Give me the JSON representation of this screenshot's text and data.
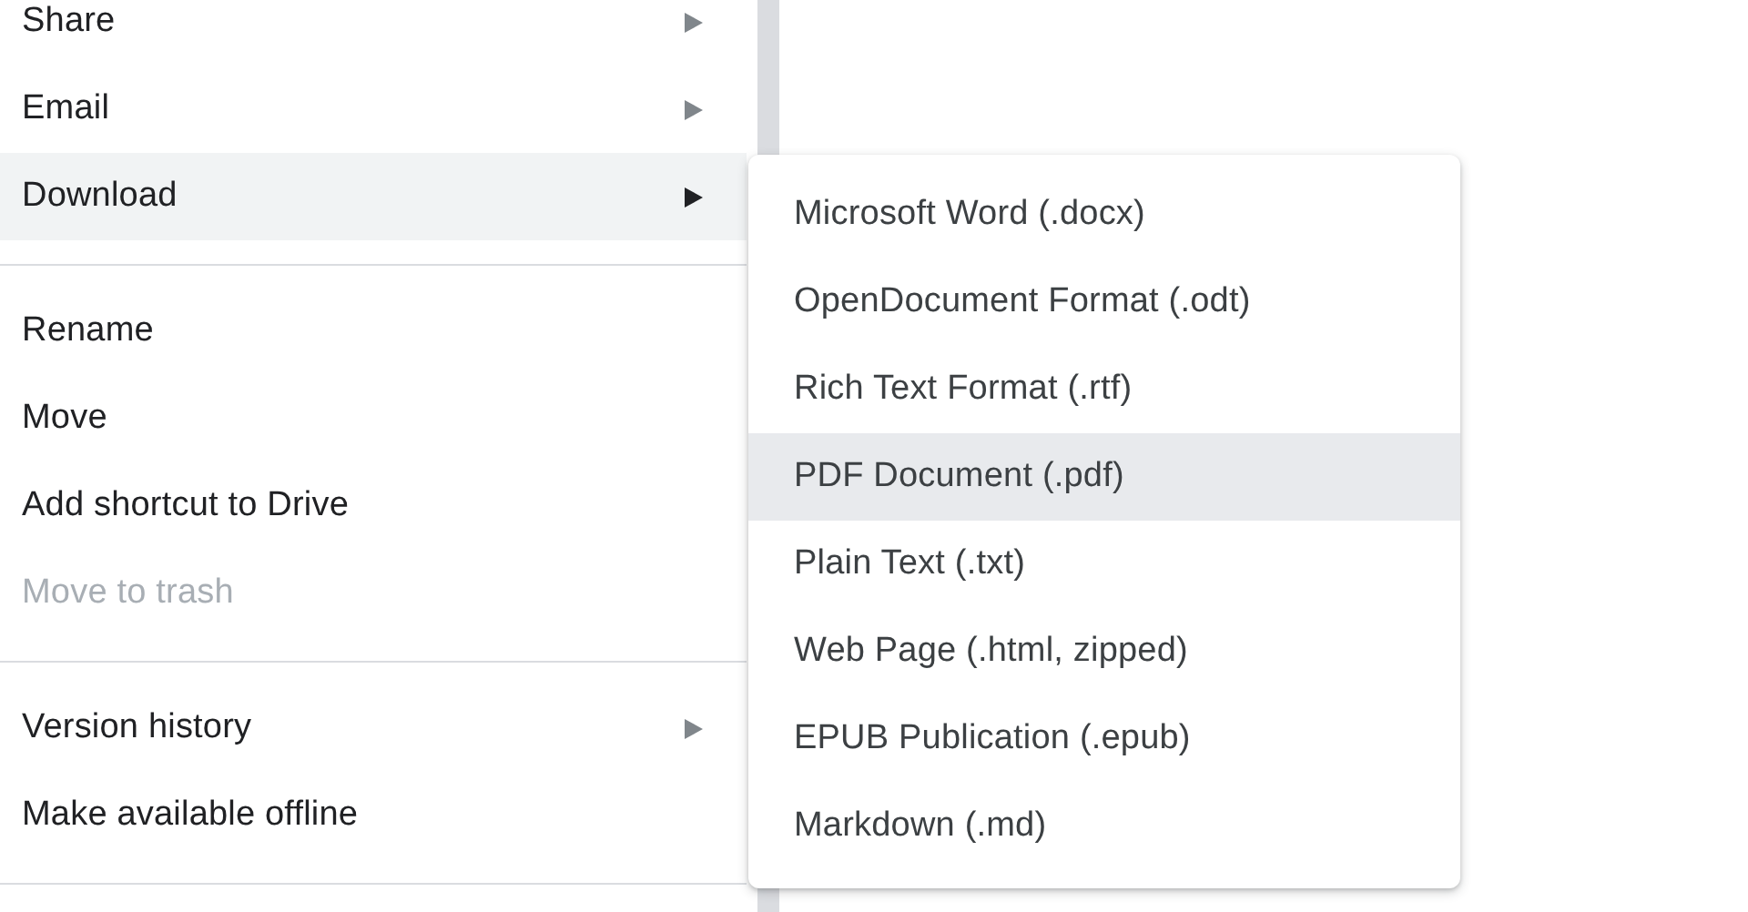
{
  "menu": {
    "groups": [
      {
        "items": [
          {
            "label": "Share",
            "has_submenu": true,
            "selected": false,
            "disabled": false
          },
          {
            "label": "Email",
            "has_submenu": true,
            "selected": false,
            "disabled": false
          },
          {
            "label": "Download",
            "has_submenu": true,
            "selected": true,
            "disabled": false
          }
        ]
      },
      {
        "items": [
          {
            "label": "Rename",
            "has_submenu": false,
            "selected": false,
            "disabled": false
          },
          {
            "label": "Move",
            "has_submenu": false,
            "selected": false,
            "disabled": false
          },
          {
            "label": "Add shortcut to Drive",
            "has_submenu": false,
            "selected": false,
            "disabled": false
          },
          {
            "label": "Move to trash",
            "has_submenu": false,
            "selected": false,
            "disabled": true
          }
        ]
      },
      {
        "items": [
          {
            "label": "Version history",
            "has_submenu": true,
            "selected": false,
            "disabled": false
          },
          {
            "label": "Make available offline",
            "has_submenu": false,
            "selected": false,
            "disabled": false
          }
        ]
      }
    ]
  },
  "submenu": {
    "items": [
      {
        "label": "Microsoft Word (.docx)",
        "selected": false
      },
      {
        "label": "OpenDocument Format (.odt)",
        "selected": false
      },
      {
        "label": "Rich Text Format (.rtf)",
        "selected": false
      },
      {
        "label": "PDF Document (.pdf)",
        "selected": true
      },
      {
        "label": "Plain Text (.txt)",
        "selected": false
      },
      {
        "label": "Web Page (.html, zipped)",
        "selected": false
      },
      {
        "label": "EPUB Publication (.epub)",
        "selected": false
      },
      {
        "label": "Markdown (.md)",
        "selected": false
      }
    ]
  }
}
